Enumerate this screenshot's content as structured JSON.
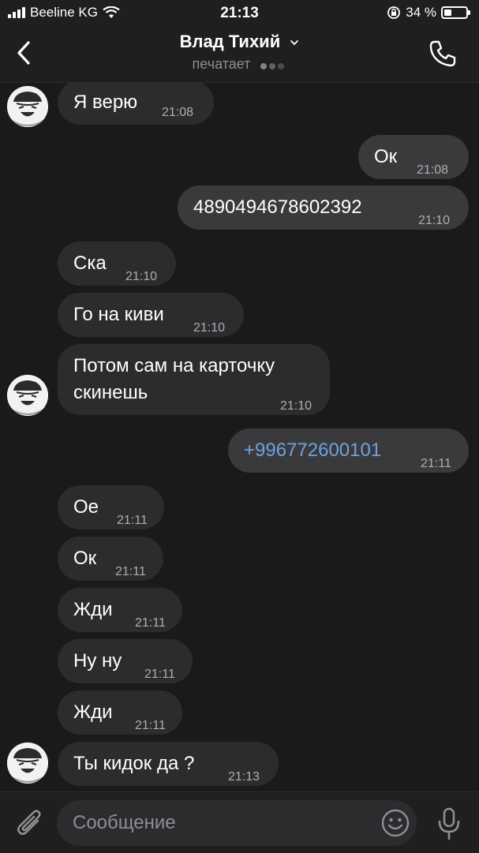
{
  "status_bar": {
    "carrier": "Beeline KG",
    "time": "21:13",
    "battery_percent": "34 %",
    "battery_level": 0.34
  },
  "header": {
    "contact_name": "Влад Тихий",
    "status": "печатает",
    "icons": {
      "back": "chevron-left-icon",
      "call": "phone-icon",
      "expand": "chevron-down-icon"
    }
  },
  "messages": [
    {
      "dir": "in",
      "text": "Я верю",
      "time": "21:08"
    },
    {
      "dir": "out",
      "text": "Ок",
      "time": "21:08"
    },
    {
      "dir": "out",
      "text": "4890494678602392",
      "time": "21:10"
    },
    {
      "dir": "in",
      "text": "Ска",
      "time": "21:10"
    },
    {
      "dir": "in",
      "text": "Го на киви",
      "time": "21:10"
    },
    {
      "dir": "in",
      "text": "Потом сам на карточку\nскинешь",
      "time": "21:10"
    },
    {
      "dir": "out",
      "text": "+996772600101",
      "time": "21:11",
      "is_link": true
    },
    {
      "dir": "in",
      "text": "Ое",
      "time": "21:11"
    },
    {
      "dir": "in",
      "text": "Ок",
      "time": "21:11"
    },
    {
      "dir": "in",
      "text": "Жди",
      "time": "21:11"
    },
    {
      "dir": "in",
      "text": "Ну ну",
      "time": "21:11"
    },
    {
      "dir": "in",
      "text": "Жди",
      "time": "21:11"
    },
    {
      "dir": "in",
      "text": "Ты кидок да ?",
      "time": "21:13"
    }
  ],
  "composer": {
    "placeholder": "Сообщение",
    "icons": {
      "attach": "paperclip-icon",
      "emoji": "emoji-icon",
      "mic": "microphone-icon"
    }
  },
  "colors": {
    "background": "#1a1a1b",
    "incoming_bubble": "#2c2c2e",
    "outgoing_bubble": "#3a3a3c",
    "link": "#6fa0de",
    "secondary_text": "#8e8e93"
  }
}
